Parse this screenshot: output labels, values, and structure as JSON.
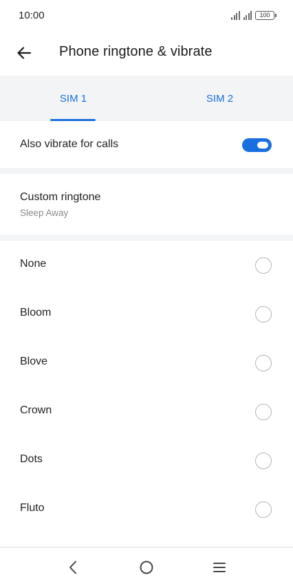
{
  "status_bar": {
    "time": "10:00",
    "battery": "100",
    "icons": [
      "signal-sim1-icon",
      "signal-sim2-icon",
      "battery-icon"
    ]
  },
  "app_bar": {
    "back_icon": "arrow-left-icon",
    "title": "Phone ringtone & vibrate"
  },
  "tabs": [
    {
      "label": "SIM 1",
      "selected": true
    },
    {
      "label": "SIM 2",
      "selected": false
    }
  ],
  "vibrate": {
    "label": "Also vibrate for calls",
    "enabled": true
  },
  "custom_ringtone": {
    "title": "Custom ringtone",
    "value": "Sleep Away"
  },
  "ringtones": [
    {
      "label": "None",
      "selected": false
    },
    {
      "label": "Bloom",
      "selected": false
    },
    {
      "label": "Blove",
      "selected": false
    },
    {
      "label": "Crown",
      "selected": false
    },
    {
      "label": "Dots",
      "selected": false
    },
    {
      "label": "Fluto",
      "selected": false
    }
  ],
  "nav_bar": {
    "icons": [
      "nav-back-icon",
      "nav-home-icon",
      "nav-menu-icon"
    ]
  },
  "colors": {
    "accent": "#1a6fe0",
    "section_bg": "#f3f4f6",
    "secondary_text": "#8a8a8a"
  }
}
